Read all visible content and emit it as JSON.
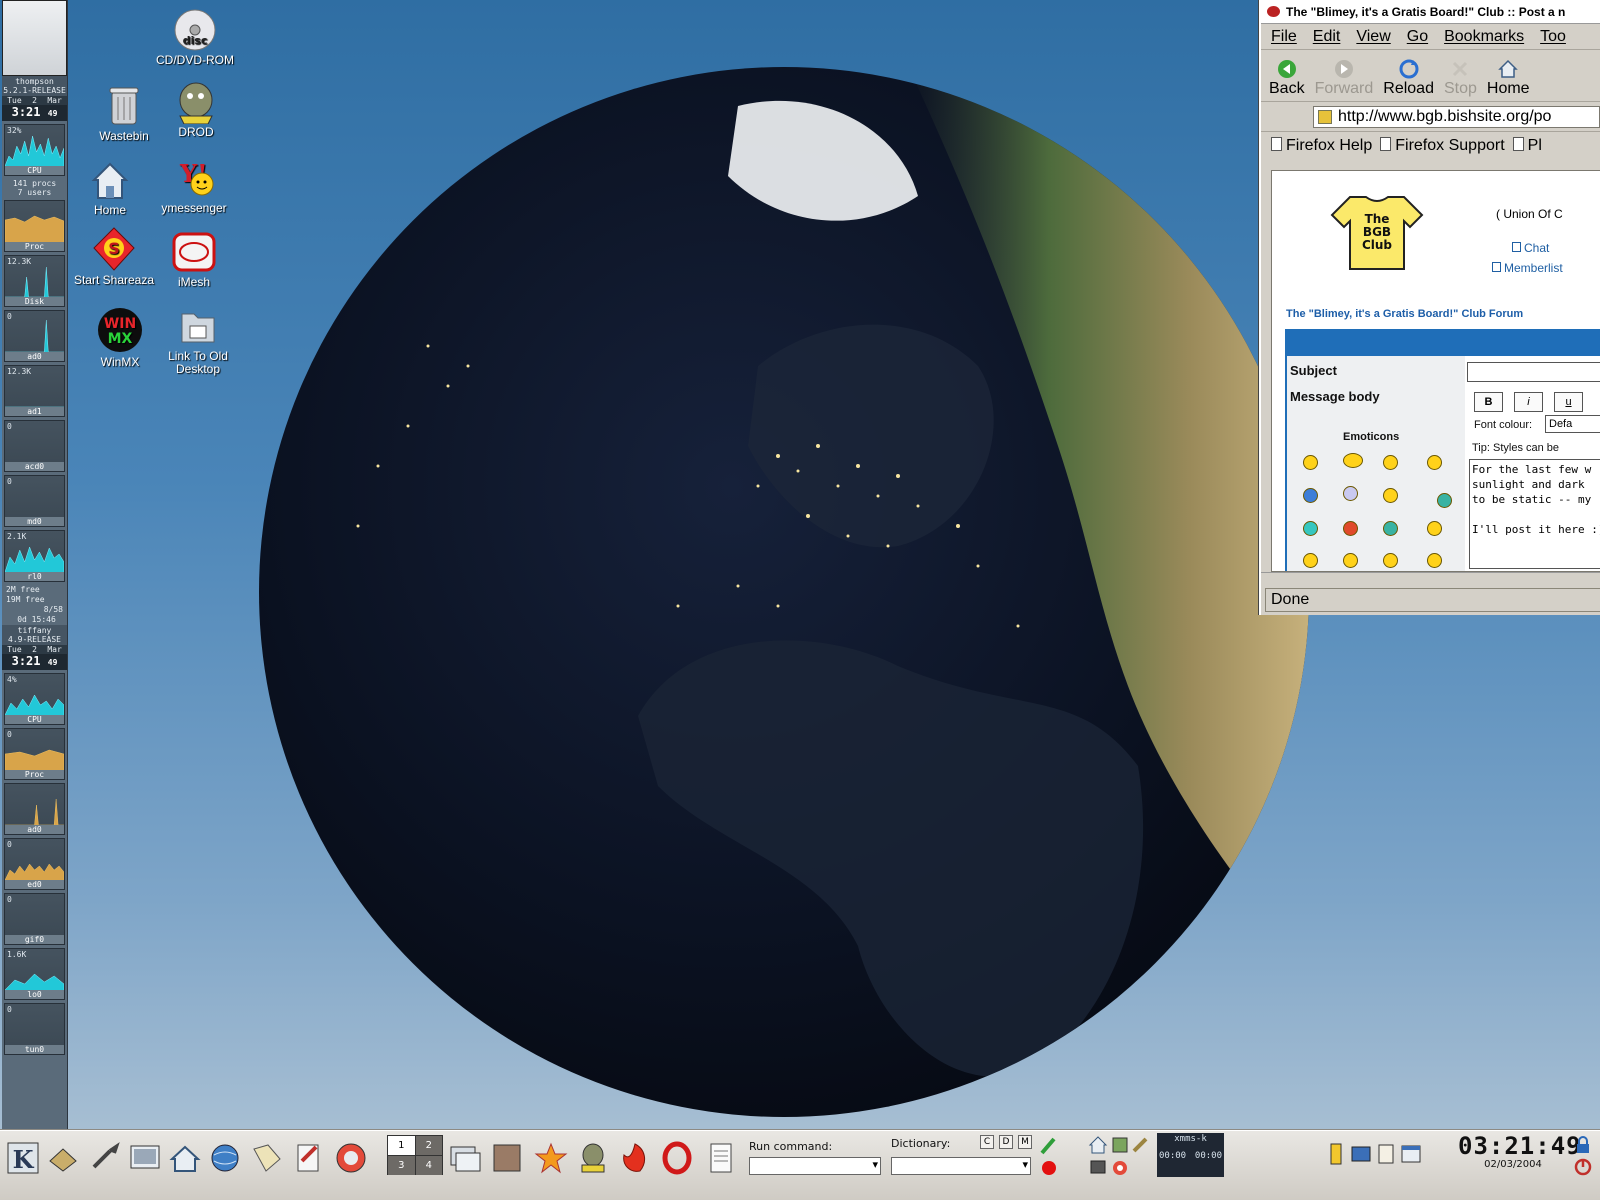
{
  "gkrellm": {
    "host1": "thompson",
    "release1": "5.2.1-RELEASE",
    "day1": "Tue",
    "date1": "2",
    "month1": "Mar",
    "time1": "3:21",
    "sec1": "49",
    "cpu_pct1": "32%",
    "cpu_label": "CPU",
    "procs": "141 procs",
    "users": "7 users",
    "proc_label": "Proc",
    "disk_val": "12.3K",
    "disk_label": "Disk",
    "ad0_val": "0",
    "ad0_label": "ad0",
    "ad1_val": "12.3K",
    "ad1_label": "ad1",
    "acd0_val": "0",
    "acd0_label": "acd0",
    "md0_val": "0",
    "md0_label": "md0",
    "rl0_val": "2.1K",
    "rl0_label": "rl0",
    "mem_free": "2M free",
    "swap_free": "19M free",
    "mail": "8/58",
    "uptime": "0d 15:46",
    "host2": "tiffany",
    "release2": "4.9-RELEASE",
    "day2": "Tue",
    "date2": "2",
    "month2": "Mar",
    "time2": "3:21",
    "sec2": "49",
    "cpu_pct2": "4%",
    "cpu_label2": "CPU",
    "proc_label2": "Proc",
    "proc_val2": "0",
    "ad0_label2": "ad0",
    "ed0_label": "ed0",
    "ed0_val": "0",
    "gif0_label": "gif0",
    "gif0_val": "0",
    "lo0_label": "lo0",
    "lo0_val": "1.6K",
    "tun0_label": "tun0",
    "tun0_val": "0"
  },
  "desktop_icons": {
    "cdrom": "CD/DVD-ROM",
    "wastebin": "Wastebin",
    "drod": "DROD",
    "home": "Home",
    "ymessenger": "ymessenger",
    "shareaza": "Start Shareaza",
    "imesh": "iMesh",
    "winmx": "WinMX",
    "old_desktop_1": "Link To Old",
    "old_desktop_2": "Desktop",
    "cd_disc_label": "disc",
    "winmx_top": "WIN",
    "winmx_bottom": "MX"
  },
  "browser": {
    "title": "The \"Blimey, it's a Gratis Board!\" Club :: Post a n",
    "menu": [
      "File",
      "Edit",
      "View",
      "Go",
      "Bookmarks",
      "Too"
    ],
    "toolbar": {
      "back": "Back",
      "forward": "Forward",
      "reload": "Reload",
      "stop": "Stop",
      "home": "Home"
    },
    "url": "http://www.bgb.bishsite.org/po",
    "bookmarks": [
      "Firefox Help",
      "Firefox Support",
      "Pl"
    ],
    "status": "Done",
    "page": {
      "logo_text": "The BGB Club",
      "logo_line1": "The",
      "logo_line2": "BGB",
      "logo_line3": "Club",
      "union": "( Union Of C",
      "chat": "Chat",
      "memberlist": "Memberlist",
      "forum_title": "The \"Blimey, it's a Gratis Board!\" Club Forum",
      "subject_label": "Subject",
      "message_body_label": "Message body",
      "bold_btn": "B",
      "italic_btn": "i",
      "underline_btn": "u",
      "font_colour_label": "Font colour:",
      "font_colour_value": "Defa",
      "tip": "Tip: Styles can be",
      "emoticons_label": "Emoticons",
      "message_text": "For the last few w\nsunlight and dark \nto be static -- my\n\nI'll post it here :)"
    }
  },
  "taskbar": {
    "pager": [
      "1",
      "2",
      "3",
      "4"
    ],
    "run_command_label": "Run command:",
    "dictionary_label": "Dictionary:",
    "dict_buttons": [
      "C",
      "D",
      "M"
    ],
    "xmms_title": "xmms-k",
    "xmms_time1": "00:00",
    "xmms_time2": "00:00",
    "clock_time": "03:21:49",
    "clock_date": "02/03/2004"
  },
  "colors": {
    "desktop_top": "#2f6ea3",
    "desktop_bottom": "#b3c6d6",
    "forum_blue": "#1f6eb8",
    "link_blue": "#1f5fa3"
  }
}
